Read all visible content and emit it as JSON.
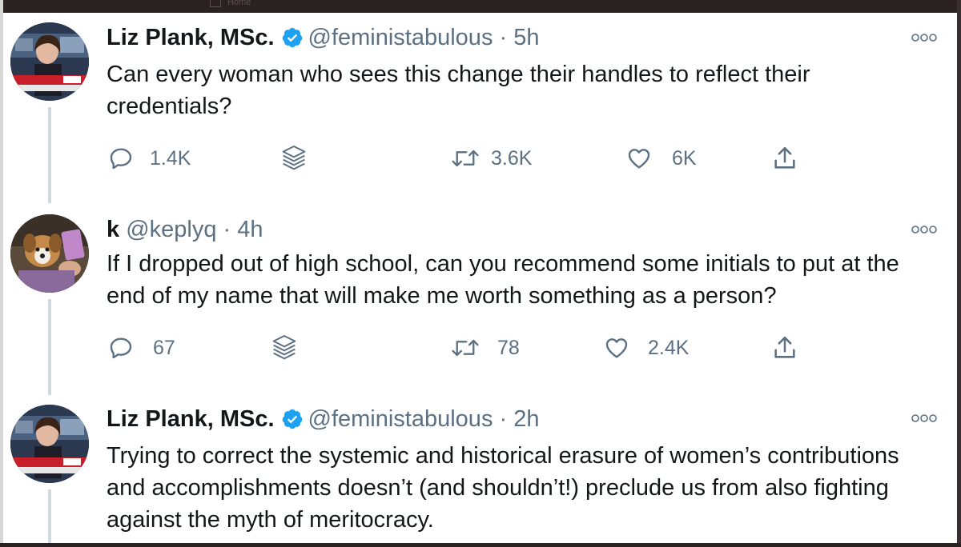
{
  "topbar": {
    "home_label": "Home"
  },
  "tweets": [
    {
      "name": "Liz Plank, MSc.",
      "handle": "@feministabulous",
      "separator": "·",
      "time": "5h",
      "text": "Can every woman who sees this  change their handles to reflect their credentials?",
      "replies": "1.4K",
      "retweets": "3.6K",
      "likes": "6K",
      "avatar": "news-studio-photo"
    },
    {
      "name": "k",
      "handle": "@keplyq",
      "separator": "·",
      "time": "4h",
      "text": "If I dropped out of high school, can you recommend some initials to put at the end of my name that will make me worth something as a person?",
      "replies": "67",
      "retweets": "78",
      "likes": "2.4K",
      "avatar": "dog-photo"
    },
    {
      "name": "Liz Plank, MSc.",
      "handle": "@feministabulous",
      "separator": "·",
      "time": "2h",
      "text": "Trying to correct the systemic and historical erasure of women’s contributions and accomplishments doesn’t (and shouldn’t!) preclude us from also fighting against the myth of meritocracy.",
      "avatar": "news-studio-photo"
    }
  ],
  "colors": {
    "verified": "#1da1f2",
    "secondary_text": "#5b7083",
    "thread_line": "#cfd9de"
  }
}
